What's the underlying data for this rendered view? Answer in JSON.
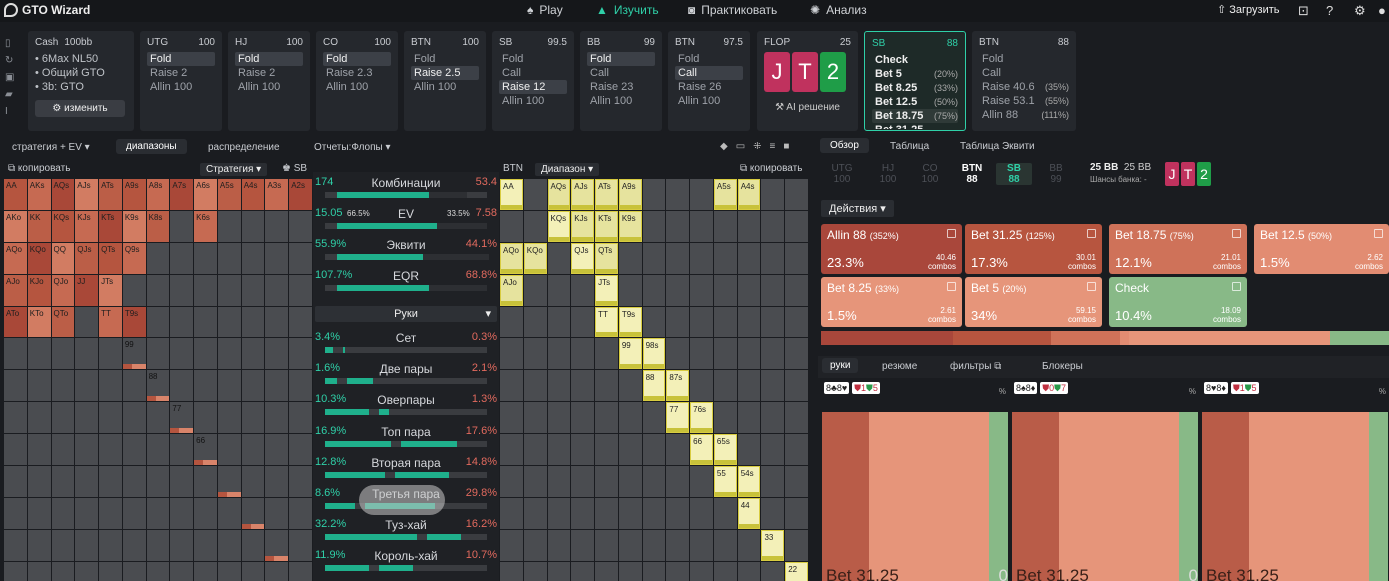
{
  "app": {
    "title": "GTO Wizard"
  },
  "nav": {
    "play": "Play",
    "study": "Изучить",
    "practice": "Практиковать",
    "analysis": "Анализ",
    "load": "Загрузить"
  },
  "spot": {
    "format": "Cash",
    "stack": "100bb",
    "details": [
      "6Max NL50",
      "Общий GTO",
      "3b: GTO"
    ],
    "change": "изменить"
  },
  "positions": [
    {
      "pos": "UTG",
      "stack": "100",
      "actions": [
        "Fold",
        "Raise 2",
        "Allin 100"
      ],
      "selected": 0
    },
    {
      "pos": "HJ",
      "stack": "100",
      "actions": [
        "Fold",
        "Raise 2",
        "Allin 100"
      ],
      "selected": 0
    },
    {
      "pos": "CO",
      "stack": "100",
      "actions": [
        "Fold",
        "Raise 2.3",
        "Allin 100"
      ],
      "selected": 0
    },
    {
      "pos": "BTN",
      "stack": "100",
      "actions": [
        "Fold",
        "Raise 2.5",
        "Allin 100"
      ],
      "selected": 1
    },
    {
      "pos": "SB",
      "stack": "99.5",
      "actions": [
        "Fold",
        "Call",
        "Raise 12",
        "Allin 100"
      ],
      "selected": 2
    },
    {
      "pos": "BB",
      "stack": "99",
      "actions": [
        "Fold",
        "Call",
        "Raise 23",
        "Allin 100"
      ],
      "selected": 0
    },
    {
      "pos": "BTN",
      "stack": "97.5",
      "actions": [
        "Fold",
        "Call",
        "Raise 26",
        "Allin 100"
      ],
      "selected": 1
    }
  ],
  "flop": {
    "label": "FLOP",
    "pot": "25",
    "cards": [
      "J",
      "T",
      "2"
    ],
    "ai": "AI решение"
  },
  "sb_node": {
    "pos": "SB",
    "stack": "88",
    "actions": [
      {
        "a": "Check",
        "p": ""
      },
      {
        "a": "Bet 5",
        "p": "(20%)"
      },
      {
        "a": "Bet 8.25",
        "p": "(33%)"
      },
      {
        "a": "Bet 12.5",
        "p": "(50%)"
      },
      {
        "a": "Bet 18.75",
        "p": "(75%)"
      },
      {
        "a": "Bet 31.25",
        "p": ""
      }
    ]
  },
  "btn_node": {
    "pos": "BTN",
    "stack": "88",
    "actions": [
      {
        "a": "Fold",
        "p": ""
      },
      {
        "a": "Call",
        "p": ""
      },
      {
        "a": "Raise 40.6",
        "p": "(35%)"
      },
      {
        "a": "Raise 53.1",
        "p": "(55%)"
      },
      {
        "a": "Allin 88",
        "p": "(111%)"
      }
    ]
  },
  "left_tabs": {
    "strategy_ev": "стратегия + EV",
    "ranges": "диапазоны",
    "distribution": "распределение",
    "reports": "Отчеты:Флопы"
  },
  "left_sub": {
    "copy": "копировать",
    "strategy": "Стратегия",
    "sb": "SB",
    "btn": "BTN",
    "range": "Диапазон",
    "copy2": "копировать"
  },
  "stats": {
    "combos": {
      "l": "174",
      "t": "Комбинации",
      "r": "53.4"
    },
    "ev": {
      "l": "15.05",
      "lm": "66.5%",
      "t": "EV",
      "rm": "33.5%",
      "r": "7.58"
    },
    "equity": {
      "l": "55.9%",
      "t": "Эквити",
      "r": "44.1%"
    },
    "eqr": {
      "l": "107.7%",
      "t": "EQR",
      "r": "68.8%"
    },
    "hands_select": "Руки",
    "rows": [
      {
        "l": "3.4%",
        "t": "Сет",
        "r": "0.3%"
      },
      {
        "l": "1.6%",
        "t": "Две пары",
        "r": "2.1%"
      },
      {
        "l": "10.3%",
        "t": "Оверпары",
        "r": "1.3%"
      },
      {
        "l": "16.9%",
        "t": "Топ пара",
        "r": "17.6%"
      },
      {
        "l": "12.8%",
        "t": "Вторая пара",
        "r": "14.8%"
      },
      {
        "l": "8.6%",
        "t": "Третья пара",
        "r": "29.8%"
      },
      {
        "l": "32.2%",
        "t": "Туз-хай",
        "r": "16.2%"
      },
      {
        "l": "11.9%",
        "t": "Король-хай",
        "r": "10.7%"
      }
    ]
  },
  "right_tabs": {
    "overview": "Обзор",
    "table": "Таблица",
    "equity_table": "Таблица Эквити"
  },
  "seats": [
    {
      "p": "UTG",
      "s": "100"
    },
    {
      "p": "HJ",
      "s": "100"
    },
    {
      "p": "CO",
      "s": "100"
    },
    {
      "p": "BTN",
      "s": "88"
    },
    {
      "p": "SB",
      "s": "88"
    },
    {
      "p": "BB",
      "s": "99"
    }
  ],
  "pot": {
    "main": "25 BB",
    "side": "25 BB",
    "label": "Шансы банка:",
    "value": "-"
  },
  "actions_label": "Действия",
  "action_boxes": [
    {
      "name": "Allin 88",
      "pct": "(352%)",
      "freq": "23.3%",
      "combos": "40.46"
    },
    {
      "name": "Bet 31.25",
      "pct": "(125%)",
      "freq": "17.3%",
      "combos": "30.01"
    },
    {
      "name": "Bet 18.75",
      "pct": "(75%)",
      "freq": "12.1%",
      "combos": "21.01"
    },
    {
      "name": "Bet 12.5",
      "pct": "(50%)",
      "freq": "1.5%",
      "combos": "2.62"
    },
    {
      "name": "Bet 8.25",
      "pct": "(33%)",
      "freq": "1.5%",
      "combos": "2.61"
    },
    {
      "name": "Bet 5",
      "pct": "(20%)",
      "freq": "34%",
      "combos": "59.15"
    },
    {
      "name": "Check",
      "pct": "",
      "freq": "10.4%",
      "combos": "18.09"
    }
  ],
  "combos_word": "combos",
  "hands_tabs": {
    "hands": "руки",
    "summary": "резюме",
    "filters": "фильтры",
    "blockers": "Блокеры"
  },
  "combo_cards": [
    {
      "hand": "8♣8♥",
      "b1": "1",
      "b2": "5",
      "bottom": "Bet 31.25",
      "pc": "%"
    },
    {
      "hand": "8♠8♦",
      "b1": "0",
      "b2": "7",
      "bottom": "Bet 31.25",
      "pc": "%"
    },
    {
      "hand": "8♥8♦",
      "b1": "1",
      "b2": "5",
      "bottom": "Bet 31.25",
      "pc": "%"
    }
  ],
  "combo_trailing": [
    "0",
    "0"
  ],
  "colors": {
    "accent": "#2fd0a8",
    "allin": "#a9473b",
    "bet_big": "#c0604b",
    "bet_mid": "#d9846a",
    "bet_small": "#e6957a",
    "check": "#88b987"
  },
  "grid_left_labels": [
    [
      "AA",
      "AKs",
      "AQs",
      "AJs",
      "ATs",
      "A9s",
      "A8s",
      "A7s",
      "A6s",
      "A5s",
      "A4s",
      "A3s",
      "A2s"
    ],
    [
      "AKo",
      "KK",
      "KQs",
      "KJs",
      "KTs",
      "K9s",
      "K8s",
      "",
      "K6s",
      "",
      "",
      "",
      ""
    ],
    [
      "AQo",
      "KQo",
      "QQ",
      "QJs",
      "QTs",
      "Q9s",
      "",
      "",
      "",
      "",
      "",
      "",
      ""
    ],
    [
      "AJo",
      "KJo",
      "QJo",
      "JJ",
      "JTs",
      "",
      "",
      "",
      "",
      "",
      "",
      "",
      ""
    ],
    [
      "ATo",
      "KTo",
      "QTo",
      "",
      "TT",
      "T9s",
      "",
      "",
      "",
      "",
      "",
      "",
      ""
    ],
    [
      "",
      "",
      "",
      "",
      "",
      "99",
      "",
      "",
      "",
      "",
      "",
      "",
      ""
    ],
    [
      "",
      "",
      "",
      "",
      "",
      "",
      "88",
      "",
      "",
      "",
      "",
      "",
      ""
    ],
    [
      "",
      "",
      "",
      "",
      "",
      "",
      "",
      "77",
      "",
      "",
      "",
      "",
      ""
    ],
    [
      "",
      "",
      "",
      "",
      "",
      "",
      "",
      "",
      "66",
      "",
      "",
      "",
      ""
    ],
    [
      "",
      "",
      "",
      "",
      "",
      "",
      "",
      "",
      "",
      "",
      "",
      "",
      ""
    ],
    [
      "",
      "",
      "",
      "",
      "",
      "",
      "",
      "",
      "",
      "",
      "",
      "",
      ""
    ],
    [
      "",
      "",
      "",
      "",
      "",
      "",
      "",
      "",
      "",
      "",
      "",
      "",
      ""
    ],
    [
      "",
      "",
      "",
      "",
      "",
      "",
      "",
      "",
      "",
      "",
      "",
      "",
      ""
    ]
  ],
  "grid_right_labels": [
    [
      "AA",
      "",
      "AQs",
      "AJs",
      "ATs",
      "A9s",
      "",
      "",
      "",
      "A5s",
      "A4s",
      "",
      ""
    ],
    [
      "",
      "",
      "KQs",
      "KJs",
      "KTs",
      "K9s",
      "",
      "",
      "",
      "",
      "",
      "",
      ""
    ],
    [
      "AQo",
      "KQo",
      "",
      "QJs",
      "QTs",
      "",
      "",
      "",
      "",
      "",
      "",
      "",
      ""
    ],
    [
      "AJo",
      "",
      "",
      "",
      "JTs",
      "",
      "",
      "",
      "",
      "",
      "",
      "",
      ""
    ],
    [
      "",
      "",
      "",
      "",
      "TT",
      "T9s",
      "",
      "",
      "",
      "",
      "",
      "",
      ""
    ],
    [
      "",
      "",
      "",
      "",
      "",
      "99",
      "98s",
      "",
      "",
      "",
      "",
      "",
      ""
    ],
    [
      "",
      "",
      "",
      "",
      "",
      "",
      "88",
      "87s",
      "",
      "",
      "",
      "",
      ""
    ],
    [
      "",
      "",
      "",
      "",
      "",
      "",
      "",
      "77",
      "76s",
      "",
      "",
      "",
      ""
    ],
    [
      "",
      "",
      "",
      "",
      "",
      "",
      "",
      "",
      "66",
      "65s",
      "",
      "",
      ""
    ],
    [
      "",
      "",
      "",
      "",
      "",
      "",
      "",
      "",
      "",
      "55",
      "54s",
      "",
      ""
    ],
    [
      "",
      "",
      "",
      "",
      "",
      "",
      "",
      "",
      "",
      "",
      "44",
      "",
      ""
    ],
    [
      "",
      "",
      "",
      "",
      "",
      "",
      "",
      "",
      "",
      "",
      "",
      "33",
      ""
    ],
    [
      "",
      "",
      "",
      "",
      "",
      "",
      "",
      "",
      "",
      "",
      "",
      "",
      "22"
    ]
  ]
}
